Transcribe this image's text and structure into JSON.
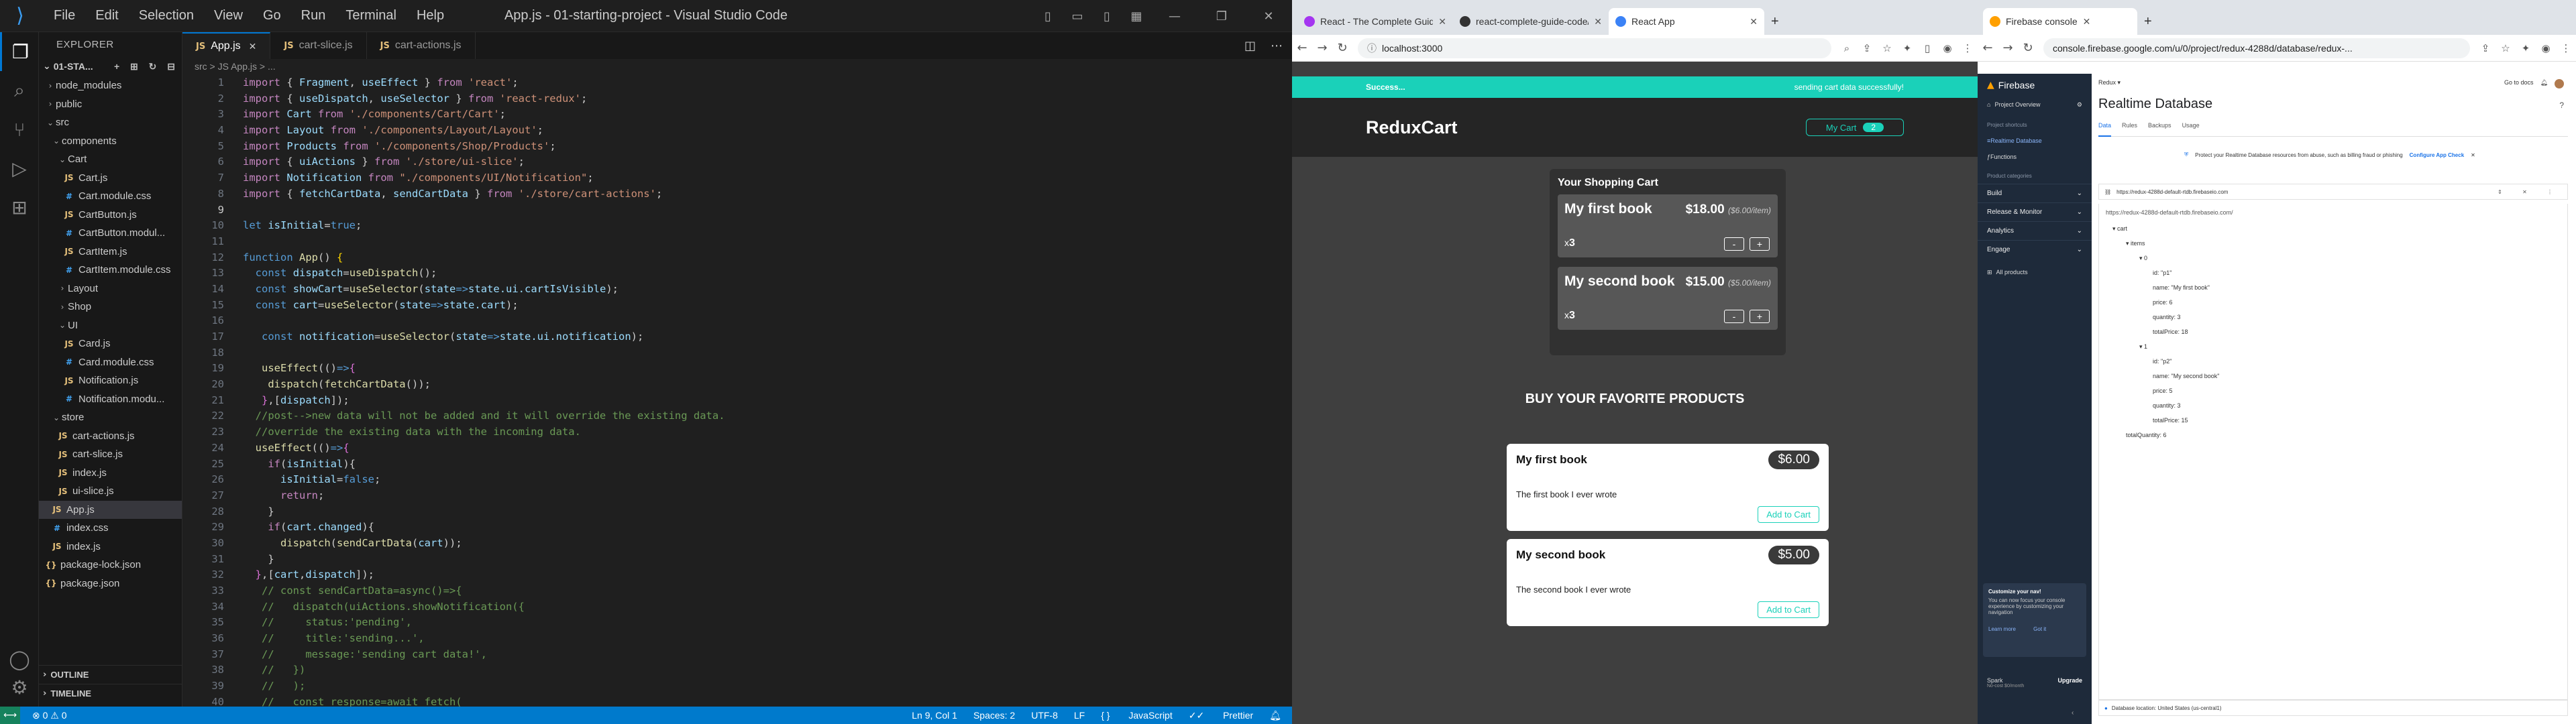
{
  "vscode": {
    "title": "App.js - 01-starting-project - Visual Studio Code",
    "menu": [
      "File",
      "Edit",
      "Selection",
      "View",
      "Go",
      "Run",
      "Terminal",
      "Help"
    ],
    "explorer_label": "EXPLORER",
    "project_name": "01-STA...",
    "tree": [
      {
        "label": "node_modules",
        "type": "folder",
        "indent": 1,
        "open": false
      },
      {
        "label": "public",
        "type": "folder",
        "indent": 1,
        "open": false
      },
      {
        "label": "src",
        "type": "folder",
        "indent": 1,
        "open": true
      },
      {
        "label": "components",
        "type": "folder",
        "indent": 2,
        "open": true
      },
      {
        "label": "Cart",
        "type": "folder",
        "indent": 3,
        "open": true
      },
      {
        "label": "Cart.js",
        "type": "js",
        "indent": 4
      },
      {
        "label": "Cart.module.css",
        "type": "css",
        "indent": 4
      },
      {
        "label": "CartButton.js",
        "type": "js",
        "indent": 4
      },
      {
        "label": "CartButton.modul...",
        "type": "css",
        "indent": 4
      },
      {
        "label": "CartItem.js",
        "type": "js",
        "indent": 4
      },
      {
        "label": "CartItem.module.css",
        "type": "css",
        "indent": 4
      },
      {
        "label": "Layout",
        "type": "folder",
        "indent": 3,
        "open": false
      },
      {
        "label": "Shop",
        "type": "folder",
        "indent": 3,
        "open": false
      },
      {
        "label": "UI",
        "type": "folder",
        "indent": 3,
        "open": true
      },
      {
        "label": "Card.js",
        "type": "js",
        "indent": 4
      },
      {
        "label": "Card.module.css",
        "type": "css",
        "indent": 4
      },
      {
        "label": "Notification.js",
        "type": "js",
        "indent": 4
      },
      {
        "label": "Notification.modu...",
        "type": "css",
        "indent": 4
      },
      {
        "label": "store",
        "type": "folder",
        "indent": 2,
        "open": true
      },
      {
        "label": "cart-actions.js",
        "type": "js",
        "indent": 3
      },
      {
        "label": "cart-slice.js",
        "type": "js",
        "indent": 3
      },
      {
        "label": "index.js",
        "type": "js",
        "indent": 3
      },
      {
        "label": "ui-slice.js",
        "type": "js",
        "indent": 3
      },
      {
        "label": "App.js",
        "type": "js",
        "indent": 2,
        "selected": true
      },
      {
        "label": "index.css",
        "type": "css",
        "indent": 2
      },
      {
        "label": "index.js",
        "type": "js",
        "indent": 2
      },
      {
        "label": "package-lock.json",
        "type": "json",
        "indent": 1
      },
      {
        "label": "package.json",
        "type": "json",
        "indent": 1
      }
    ],
    "outline_label": "OUTLINE",
    "timeline_label": "TIMELINE",
    "tabs": [
      {
        "label": "App.js",
        "active": true
      },
      {
        "label": "cart-slice.js",
        "active": false
      },
      {
        "label": "cart-actions.js",
        "active": false
      }
    ],
    "breadcrumb": "src > JS App.js > ...",
    "code": [
      "<span class=k>import</span> { <span class=v>Fragment</span>, <span class=v>useEffect</span> } <span class=k>from</span> <span class=s>'react'</span>;",
      "<span class=k>import</span> { <span class=v>useDispatch</span>, <span class=v>useSelector</span> } <span class=k>from</span> <span class=s>'react-redux'</span>;",
      "<span class=k>import</span> <span class=v>Cart</span> <span class=k>from</span> <span class=s>'./components/Cart/Cart'</span>;",
      "<span class=k>import</span> <span class=v>Layout</span> <span class=k>from</span> <span class=s>'./components/Layout/Layout'</span>;",
      "<span class=k>import</span> <span class=v>Products</span> <span class=k>from</span> <span class=s>'./components/Shop/Products'</span>;",
      "<span class=k>import</span> { <span class=v>uiActions</span> } <span class=k>from</span> <span class=s>'./store/ui-slice'</span>;",
      "<span class=k>import</span> <span class=v>Notification</span> <span class=k>from</span> <span class=s>\"./components/UI/Notification\"</span>;",
      "<span class=k>import</span> { <span class=v>fetchCartData</span>, <span class=v>sendCartData</span> } <span class=k>from</span> <span class=s>'./store/cart-actions'</span>;",
      "",
      "<span class=b>let</span> <span class=v>isInitial</span>=<span class=b>true</span>;",
      "",
      "<span class=b>function</span> <span class=f>App</span>() <span class=p>{</span>",
      "  <span class=b>const</span> <span class=v>dispatch</span>=<span class=f>useDispatch</span>();",
      "  <span class=b>const</span> <span class=v>showCart</span>=<span class=f>useSelector</span>(<span class=v>state</span><span class=b>=></span><span class=v>state.ui.cartIsVisible</span>);",
      "  <span class=b>const</span> <span class=v>cart</span>=<span class=f>useSelector</span>(<span class=v>state</span><span class=b>=></span><span class=v>state.cart</span>);",
      "",
      "   <span class=b>const</span> <span class=v>notification</span>=<span class=f>useSelector</span>(<span class=v>state</span><span class=b>=></span><span class=v>state.ui.notification</span>);",
      "",
      "   <span class=f>useEffect</span>(()<span class=b>=></span><span class=p2>{</span>",
      "    <span class=f>dispatch</span>(<span class=f>fetchCartData</span>());",
      "   <span class=p2>}</span>,[<span class=v>dispatch</span>]);",
      "  <span class=c>//post-->new data will not be added and it will override the existing data.</span>",
      "  <span class=c>//override the existing data with the incoming data.</span>",
      "  <span class=f>useEffect</span>(()<span class=b>=></span><span class=p2>{</span>",
      "    <span class=k>if</span>(<span class=v>isInitial</span>){",
      "      <span class=v>isInitial</span>=<span class=b>false</span>;",
      "      <span class=k>return</span>;",
      "    }",
      "    <span class=k>if</span>(<span class=v>cart.changed</span>){",
      "      <span class=f>dispatch</span>(<span class=f>sendCartData</span>(<span class=v>cart</span>));",
      "    }",
      "  <span class=p2>}</span>,[<span class=v>cart</span>,<span class=v>dispatch</span>]);",
      "   <span class=c>// const sendCartData=async()=>{</span>",
      "   <span class=c>//   dispatch(uiActions.showNotification({</span>",
      "   <span class=c>//     status:'pending',</span>",
      "   <span class=c>//     title:'sending...',</span>",
      "   <span class=c>//     message:'sending cart data!',</span>",
      "   <span class=c>//   })</span>",
      "   <span class=c>//   );</span>",
      "   <span class=c>//   const response=await fetch(</span>"
    ],
    "current_line": 9,
    "status": {
      "errors": "0",
      "warnings": "0",
      "position": "Ln 9, Col 1",
      "spaces": "Spaces: 2",
      "encoding": "UTF-8",
      "eol": "LF",
      "language": "JavaScript",
      "prettier": "Prettier"
    }
  },
  "react_browser": {
    "tabs": [
      {
        "label": "React - The Complete Guide (incl",
        "active": false,
        "color": "#a435f0"
      },
      {
        "label": "react-complete-guide-code/Co",
        "active": false,
        "color": "#333333"
      },
      {
        "label": "React App",
        "active": true,
        "color": "#3b82f6"
      }
    ],
    "url": "localhost:3000",
    "notification": {
      "title": "Success...",
      "message": "sending cart data successfully!"
    },
    "brand": "ReduxCart",
    "my_cart_label": "My Cart",
    "cart_count": "2",
    "cart_title": "Your Shopping Cart",
    "cart_items": [
      {
        "name": "My first book",
        "total": "$18.00",
        "each": "($6.00/item)",
        "qty": "3"
      },
      {
        "name": "My second book",
        "total": "$15.00",
        "each": "($5.00/item)",
        "qty": "3"
      }
    ],
    "qty_prefix": "x",
    "minus": "-",
    "plus": "+",
    "products_heading": "BUY YOUR FAVORITE PRODUCTS",
    "products": [
      {
        "name": "My first book",
        "price": "$6.00",
        "desc": "The first book I ever wrote",
        "cta": "Add to Cart"
      },
      {
        "name": "My second book",
        "price": "$5.00",
        "desc": "The second book I ever wrote",
        "cta": "Add to Cart"
      }
    ]
  },
  "firebase_browser": {
    "tab": "Firebase console",
    "url": "console.firebase.google.com/u/0/project/redux-4288d/database/redux-...",
    "app_name": "Firebase",
    "project": "Redux",
    "docs": "Go to docs",
    "side_overview": "Project Overview",
    "side_shortcuts": "Project shortcuts",
    "side_items": [
      "Realtime Database",
      "Functions"
    ],
    "side_categories_label": "Product categories",
    "side_sections": [
      "Build",
      "Release & Monitor",
      "Analytics",
      "Engage"
    ],
    "side_all": "All products",
    "customize_title": "Customize your nav!",
    "customize_text": "You can now focus your console experience by customizing your navigation",
    "learn_more": "Learn more",
    "got_it": "Got it",
    "plan": "Spark",
    "plan_sub": "No-cost $0/month",
    "upgrade": "Upgrade",
    "page_title": "Realtime Database",
    "tabs": [
      "Data",
      "Rules",
      "Backups",
      "Usage"
    ],
    "banner": "Protect your Realtime Database resources from abuse, such as billing fraud or phishing",
    "banner_link": "Configure App Check",
    "db_url": "https://redux-4288d-default-rtdb.firebaseio.com",
    "root_url": "https://redux-4288d-default-rtdb.firebaseio.com/",
    "tree": [
      {
        "k": "cart",
        "v": "",
        "d": 0
      },
      {
        "k": "items",
        "v": "",
        "d": 1
      },
      {
        "k": "0",
        "v": "",
        "d": 2
      },
      {
        "k": "id",
        "v": "\"p1\"",
        "d": 3
      },
      {
        "k": "name",
        "v": "\"My first book\"",
        "d": 3
      },
      {
        "k": "price",
        "v": "6",
        "d": 3
      },
      {
        "k": "quantity",
        "v": "3",
        "d": 3
      },
      {
        "k": "totalPrice",
        "v": "18",
        "d": 3
      },
      {
        "k": "1",
        "v": "",
        "d": 2
      },
      {
        "k": "id",
        "v": "\"p2\"",
        "d": 3
      },
      {
        "k": "name",
        "v": "\"My second book\"",
        "d": 3
      },
      {
        "k": "price",
        "v": "5",
        "d": 3
      },
      {
        "k": "quantity",
        "v": "3",
        "d": 3
      },
      {
        "k": "totalPrice",
        "v": "15",
        "d": 3
      },
      {
        "k": "totalQuantity",
        "v": "6",
        "d": 1
      }
    ],
    "location": "Database location: United States (us-central1)"
  }
}
